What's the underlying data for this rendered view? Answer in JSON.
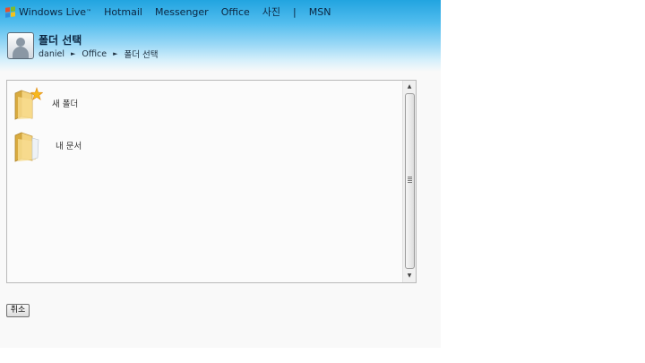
{
  "header": {
    "brand": "Windows Live",
    "brand_tm": "™",
    "nav": [
      "Hotmail",
      "Messenger",
      "Office",
      "사진"
    ],
    "separator": "|",
    "nav_last": "MSN",
    "flag_colors": [
      "#e5502d",
      "#7fba2a",
      "#2a8ee0",
      "#f6c21a"
    ]
  },
  "page": {
    "title": "폴더 선택",
    "breadcrumb": [
      "daniel",
      "Office",
      "폴더 선택"
    ],
    "breadcrumb_arrow": "►",
    "avatar_icon": "user-silhouette-icon"
  },
  "folders": [
    {
      "label": "새 폴더",
      "icon": "new-folder-icon"
    },
    {
      "label": "내 문서",
      "icon": "folder-icon"
    }
  ],
  "scrollbar": {
    "up": "▲",
    "down": "▼"
  },
  "actions": {
    "cancel_label": "취소"
  }
}
